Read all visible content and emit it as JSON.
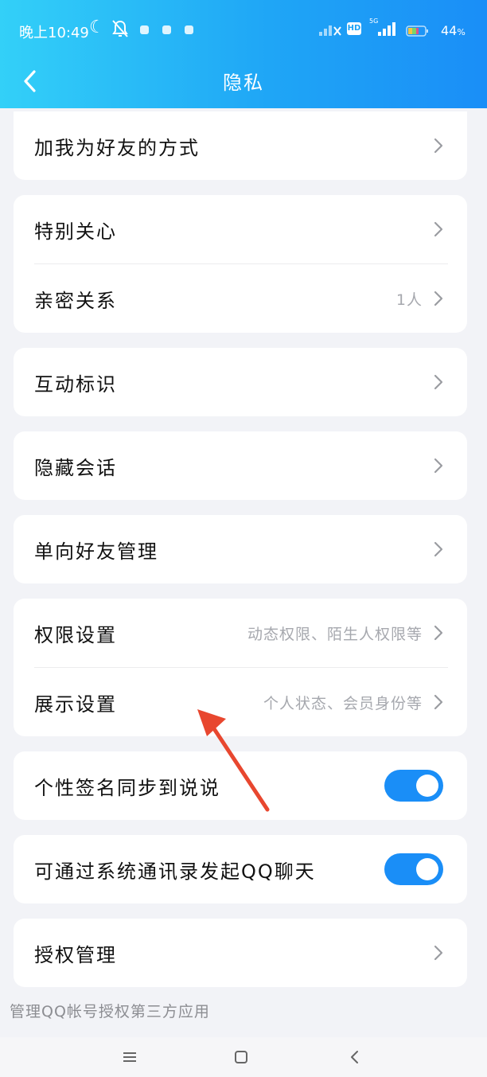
{
  "status_bar": {
    "time": "晚上10:49",
    "hd_badge": "HD",
    "network": "5G",
    "battery": "44",
    "battery_unit": "%"
  },
  "header": {
    "title": "隐私",
    "gradient_colors": [
      "#33d0f8",
      "#1a8ef7"
    ]
  },
  "rows": {
    "add_friend_method": {
      "label": "加我为好友的方式"
    },
    "special_care": {
      "label": "特别关心"
    },
    "intimate_relation": {
      "label": "亲密关系",
      "value": "1人"
    },
    "interaction_mark": {
      "label": "互动标识"
    },
    "hidden_chat": {
      "label": "隐藏会话"
    },
    "one_way_friend": {
      "label": "单向好友管理"
    },
    "permission_settings": {
      "label": "权限设置",
      "value": "动态权限、陌生人权限等"
    },
    "display_settings": {
      "label": "展示设置",
      "value": "个人状态、会员身份等"
    },
    "signature_sync": {
      "label": "个性签名同步到说说",
      "toggle_on": true
    },
    "contacts_chat": {
      "label": "可通过系统通讯录发起QQ聊天",
      "toggle_on": true
    },
    "auth_management": {
      "label": "授权管理"
    }
  },
  "footnote": "管理QQ帐号授权第三方应用",
  "colors": {
    "accent": "#1a8ef7",
    "annotation_arrow": "#e8472f"
  },
  "icons": {
    "back": "chevron-left-icon",
    "row_chevron": "chevron-right-icon",
    "menu": "menu-icon",
    "home": "home-square-icon",
    "sys_back": "back-triangle-icon"
  }
}
